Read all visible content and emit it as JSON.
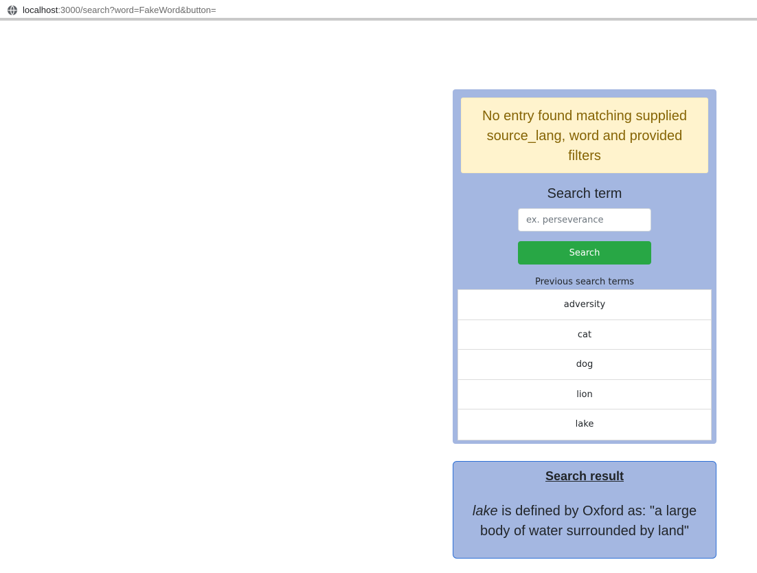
{
  "browser": {
    "url_host": "localhost",
    "url_rest": ":3000/search?word=FakeWord&button=",
    "globe_icon": "globe-icon"
  },
  "alert": {
    "message": "No entry found matching supplied source_lang, word and provided filters"
  },
  "search": {
    "heading": "Search term",
    "placeholder": "ex. perseverance",
    "value": "",
    "button_label": "Search"
  },
  "previous": {
    "label": "Previous search terms",
    "items": [
      "adversity",
      "cat",
      "dog",
      "lion",
      "lake"
    ]
  },
  "result": {
    "title": "Search result",
    "word": "lake",
    "definition_text": " is defined by Oxford as: \"a large body of water surrounded by land\""
  },
  "colors": {
    "panel_bg": "#a4b7e1",
    "alert_bg": "#fff3cd",
    "alert_text": "#856404",
    "button_bg": "#28a745",
    "result_border": "#2d6fd6"
  }
}
